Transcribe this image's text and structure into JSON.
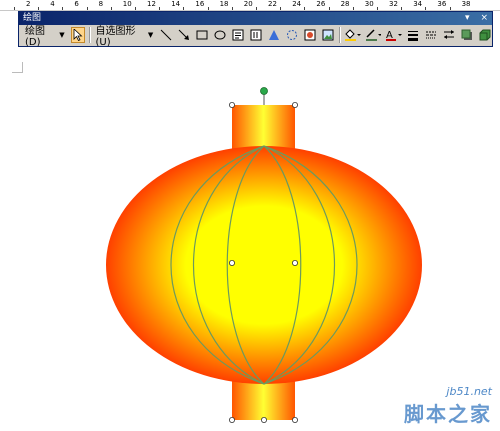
{
  "toolbar": {
    "title": "绘图",
    "draw_menu": "绘图(D)",
    "autoshapes_menu": "自选图形(U)",
    "controls": [
      "▾",
      "×"
    ]
  },
  "ruler": {
    "numbers": [
      "2",
      "4",
      "6",
      "8",
      "10",
      "12",
      "14",
      "16",
      "18",
      "20",
      "22",
      "24",
      "26",
      "28",
      "30",
      "32",
      "34",
      "36",
      "38"
    ]
  },
  "canvas": {
    "body_color_center": "#ffff00",
    "body_color_edge": "#ff1a00",
    "cap_color_center": "#ffff33",
    "cap_color_edge": "#ff5500",
    "rib_color": "#6b9a5e",
    "rotate_handle_color": "#2aa84a"
  },
  "watermark": {
    "url": "jb51.net",
    "brand": "脚本之家"
  }
}
